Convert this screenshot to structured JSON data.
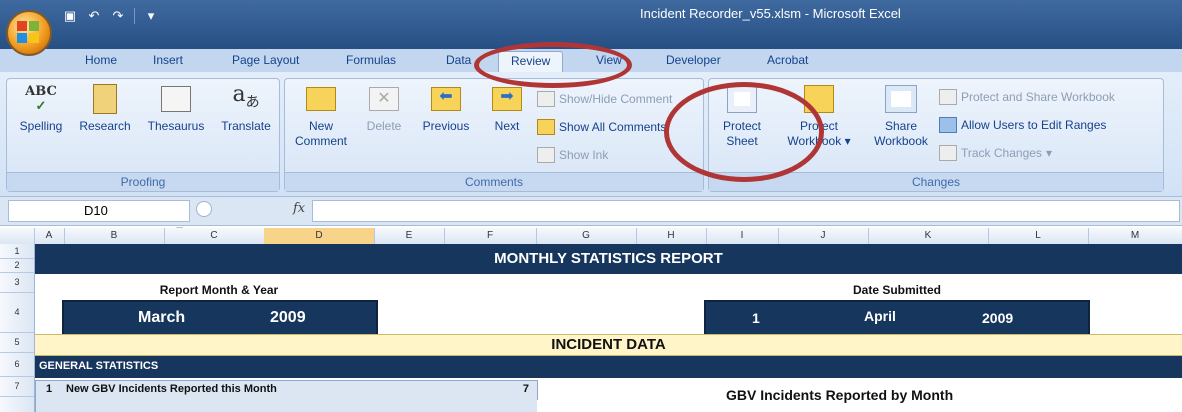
{
  "window": {
    "title": "Incident Recorder_v55.xlsm - Microsoft Excel"
  },
  "tabs": [
    "Home",
    "Insert",
    "Page Layout",
    "Formulas",
    "Data",
    "Review",
    "View",
    "Developer",
    "Acrobat"
  ],
  "active_tab": "Review",
  "ribbon": {
    "proofing": {
      "label": "Proofing",
      "spelling": "Spelling",
      "research": "Research",
      "thesaurus": "Thesaurus",
      "translate": "Translate"
    },
    "comments": {
      "label": "Comments",
      "new_l1": "New",
      "new_l2": "Comment",
      "delete": "Delete",
      "previous": "Previous",
      "next": "Next",
      "show_hide": "Show/Hide Comment",
      "show_all": "Show All Comments",
      "show_ink": "Show Ink"
    },
    "changes": {
      "label": "Changes",
      "protect_sheet_l1": "Protect",
      "protect_sheet_l2": "Sheet",
      "protect_wb_l1": "Protect",
      "protect_wb_l2": "Workbook",
      "share_l1": "Share",
      "share_l2": "Workbook",
      "protect_share": "Protect and Share Workbook",
      "allow_users": "Allow Users to Edit Ranges",
      "track_changes": "Track Changes"
    }
  },
  "formula_bar": {
    "name_box": "D10",
    "fx": "fx",
    "formula": ""
  },
  "columns": [
    "A",
    "B",
    "C",
    "D",
    "E",
    "F",
    "G",
    "H",
    "I",
    "J",
    "K",
    "L",
    "M"
  ],
  "rows": [
    "1",
    "2",
    "3",
    "4",
    "5",
    "6",
    "7"
  ],
  "sheet": {
    "title": "MONTHLY STATISTICS REPORT",
    "report_month_label": "Report Month & Year",
    "report_month": "March",
    "report_year": "2009",
    "date_submitted_label": "Date Submitted",
    "date_day": "1",
    "date_month": "April",
    "date_year": "2009",
    "incident_data": "INCIDENT DATA",
    "general_statistics": "GENERAL STATISTICS",
    "row7_num": "1",
    "row7_label": "New GBV Incidents Reported this Month",
    "row7_value": "7",
    "chart_title": "GBV Incidents Reported by Month"
  },
  "colors": {
    "navy": "#17365d",
    "cream": "#fff5c8",
    "selected_header": "#f8d48b",
    "annotation": "#b03636"
  }
}
